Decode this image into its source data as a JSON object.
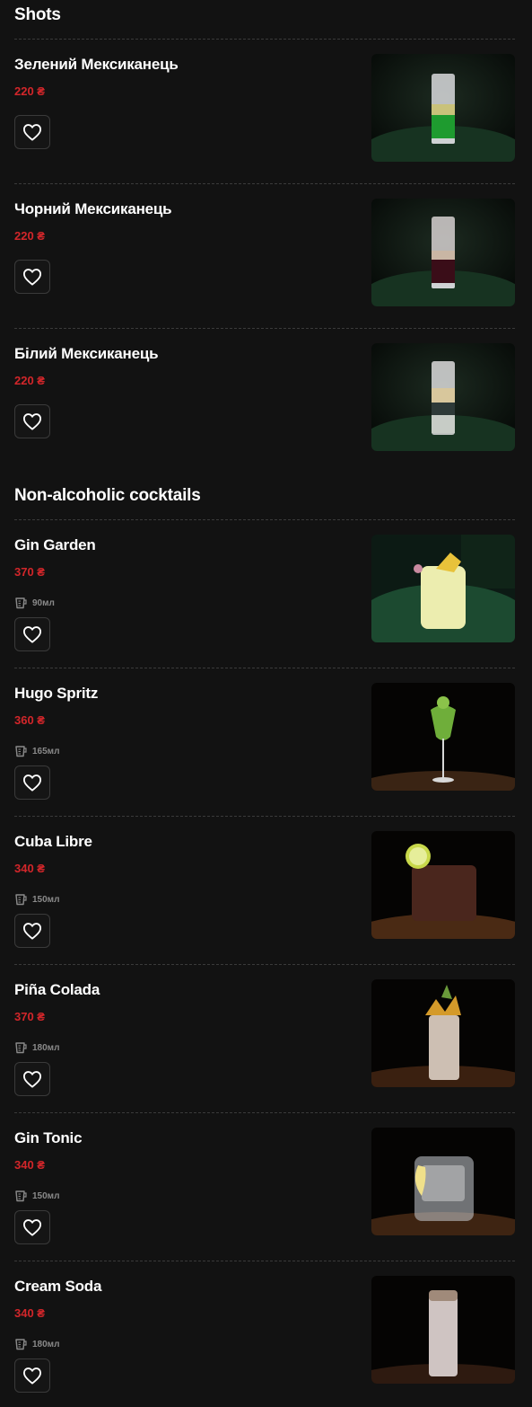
{
  "sections": [
    {
      "title": "Shots",
      "items": [
        {
          "name": "Зелений Мексиканець",
          "price": "220 ₴",
          "volume": ""
        },
        {
          "name": "Чорний Мексиканець",
          "price": "220 ₴",
          "volume": ""
        },
        {
          "name": "Білий Мексиканець",
          "price": "220 ₴",
          "volume": ""
        }
      ]
    },
    {
      "title": "Non-alcoholic cocktails",
      "items": [
        {
          "name": "Gin Garden",
          "price": "370 ₴",
          "volume": "90мл"
        },
        {
          "name": "Hugo Spritz",
          "price": "360 ₴",
          "volume": "165мл"
        },
        {
          "name": "Cuba Libre",
          "price": "340 ₴",
          "volume": "150мл"
        },
        {
          "name": "Piña Colada",
          "price": "370 ₴",
          "volume": "180мл"
        },
        {
          "name": "Gin Tonic",
          "price": "340 ₴",
          "volume": "150мл"
        },
        {
          "name": "Cream Soda",
          "price": "340 ₴",
          "volume": "180мл"
        }
      ]
    }
  ],
  "icons": {
    "favorite": "heart-outline-icon",
    "volume": "measuring-cup-icon"
  },
  "colors": {
    "background": "#121212",
    "price": "#d2262a",
    "text": "#ffffff",
    "muted": "#8a8a8a"
  }
}
